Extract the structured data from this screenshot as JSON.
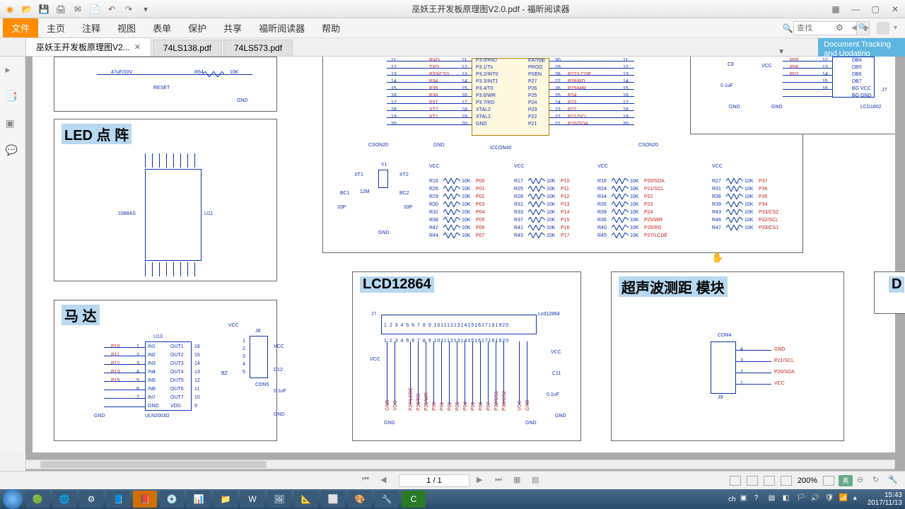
{
  "title": "巫妖王开发板原理图V2.0.pdf - 福昕阅读器",
  "menu": [
    "文件",
    "主页",
    "注释",
    "视图",
    "表单",
    "保护",
    "共享",
    "福昕阅读器",
    "帮助"
  ],
  "active_menu_index": 0,
  "search_placeholder": "查找",
  "tabs": [
    {
      "label": "巫妖王开发板原理图V2...",
      "active": true,
      "closeable": true
    },
    {
      "label": "74LS138.pdf",
      "active": false
    },
    {
      "label": "74LS573.pdf",
      "active": false
    }
  ],
  "tracking_banner_l1": "Document Tracking",
  "tracking_banner_l2": "and Updating",
  "page_indicator": "1 / 1",
  "zoom": "200%",
  "lang_toggle": "英",
  "clock_time": "15:43",
  "clock_date": "2017/11/13",
  "ime": "ch",
  "blocks": {
    "reset": {
      "cap": "47uF/10V",
      "res": "R64",
      "rval": "10K",
      "label": "RESET",
      "gnd": "GND"
    },
    "led": {
      "title": "LED 点    阵",
      "u": "U11",
      "ref": "1088AS"
    },
    "motor": {
      "title": "马 达",
      "u": "U13",
      "chip": "ULN2003D",
      "con": "CON5",
      "j": "J8",
      "vcc": "VCC",
      "gnd": "GND",
      "cap": "C12",
      "capv": "0.1uF",
      "bz": "BZ",
      "left_pins": [
        "P10",
        "P11",
        "P12",
        "P13",
        "P15"
      ],
      "left_nums": [
        "1",
        "2",
        "3",
        "4",
        "5",
        "6",
        "7"
      ],
      "in_labels": [
        "IN1",
        "IN2",
        "IN3",
        "IN4",
        "IN5",
        "IN6",
        "IN7",
        "GND"
      ],
      "out_labels": [
        "OUT1",
        "OUT2",
        "OUT3",
        "OUT4",
        "OUT5",
        "OUT6",
        "OUT7",
        "VDD"
      ],
      "right_nums": [
        "16",
        "15",
        "14",
        "13",
        "12",
        "11",
        "10",
        "9"
      ],
      "jnums": [
        "1",
        "2",
        "3",
        "4",
        "5"
      ]
    },
    "mcu": {
      "left_con": "CSON20",
      "ic": "ICCON40",
      "right_con": "CSON20",
      "gnd": "GND",
      "rows": [
        {
          "ln": "11",
          "lp": "RXD",
          "lm": "11",
          "sig": "P3.0/RxD",
          "rsig": "EA/Vpp",
          "rn": "30",
          "rp": "",
          "re": "11"
        },
        {
          "ln": "12",
          "lp": "TXD",
          "lm": "12",
          "sig": "P3.1/Tx",
          "rsig": "PROG",
          "rn": "29",
          "rp": "",
          "re": "12"
        },
        {
          "ln": "13",
          "lp": "P33/CS3",
          "lm": "13",
          "sig": "P3.2/INT0",
          "rsig": "PSEN",
          "rn": "28",
          "rp": "P27/LCDE",
          "re": "13"
        },
        {
          "ln": "14",
          "lp": "P34",
          "lm": "14",
          "sig": "P3.3/INT1",
          "rsig": "P27",
          "rn": "27",
          "rp": "P26/RD",
          "re": "14"
        },
        {
          "ln": "15",
          "lp": "P35",
          "lm": "15",
          "sig": "P3.4/T0",
          "rsig": "P26",
          "rn": "26",
          "rp": "P25/WR",
          "re": "15"
        },
        {
          "ln": "16",
          "lp": "P36",
          "lm": "16",
          "sig": "P3.6/WR",
          "rsig": "P25",
          "rn": "25",
          "rp": "P24",
          "re": "16"
        },
        {
          "ln": "17",
          "lp": "P37",
          "lm": "17",
          "sig": "P3.7/RD",
          "rsig": "P24",
          "rn": "24",
          "rp": "P23",
          "re": "17"
        },
        {
          "ln": "18",
          "lp": "XT2",
          "lm": "18",
          "sig": "XTAL2",
          "rsig": "P23",
          "rn": "23",
          "rp": "P22",
          "re": "18"
        },
        {
          "ln": "19",
          "lp": "XT1",
          "lm": "19",
          "sig": "XTAL1",
          "rsig": "P22",
          "rn": "22",
          "rp": "P21/SCL",
          "re": "19"
        },
        {
          "ln": "20",
          "lp": "",
          "lm": "20",
          "sig": "GND",
          "rsig": "P21",
          "rn": "21",
          "rp": "P20/SDA",
          "re": "20"
        }
      ],
      "xtal": {
        "y": "Y1",
        "val": "12M",
        "xt1": "XT1",
        "xt2": "XT2",
        "bc1": "BC1",
        "bc2": "BC2",
        "bcv": "33P",
        "gnd": "GND"
      },
      "rbank_headers": [
        "VCC",
        "VCC",
        "VCC",
        "VCC"
      ],
      "rbanks": [
        [
          {
            "r": "R16",
            "v": "10K",
            "n": "P00"
          },
          {
            "r": "R26",
            "v": "10K",
            "n": "P01"
          },
          {
            "r": "R29",
            "v": "10K",
            "n": "P02"
          },
          {
            "r": "R30",
            "v": "10K",
            "n": "P03"
          },
          {
            "r": "R32",
            "v": "10K",
            "n": "P04"
          },
          {
            "r": "R38",
            "v": "10K",
            "n": "P05"
          },
          {
            "r": "R42",
            "v": "10K",
            "n": "P06"
          },
          {
            "r": "R44",
            "v": "10K",
            "n": "P07"
          }
        ],
        [
          {
            "r": "R17",
            "v": "10K",
            "n": "P10"
          },
          {
            "r": "R25",
            "v": "10K",
            "n": "P11"
          },
          {
            "r": "R28",
            "v": "10K",
            "n": "P12"
          },
          {
            "r": "R31",
            "v": "10K",
            "n": "P13"
          },
          {
            "r": "R33",
            "v": "10K",
            "n": "P14"
          },
          {
            "r": "R37",
            "v": "10K",
            "n": "P15"
          },
          {
            "r": "R41",
            "v": "10K",
            "n": "P16"
          },
          {
            "r": "R43",
            "v": "10K",
            "n": "P17"
          }
        ],
        [
          {
            "r": "R18",
            "v": "10K",
            "n": "P20/SDA"
          },
          {
            "r": "R24",
            "v": "10K",
            "n": "P21/SCL"
          },
          {
            "r": "R34",
            "v": "10K",
            "n": "P22"
          },
          {
            "r": "R35",
            "v": "10K",
            "n": "P23"
          },
          {
            "r": "R39",
            "v": "10K",
            "n": "P24"
          },
          {
            "r": "R36",
            "v": "10K",
            "n": "P25/WR"
          },
          {
            "r": "R40",
            "v": "10K",
            "n": "P26/RD"
          },
          {
            "r": "R45",
            "v": "10K",
            "n": "P27/LCDE"
          }
        ],
        [
          {
            "r": "R27",
            "v": "10K",
            "n": "P37"
          },
          {
            "r": "R31",
            "v": "10K",
            "n": "P36"
          },
          {
            "r": "R36",
            "v": "10K",
            "n": "P35"
          },
          {
            "r": "R39",
            "v": "10K",
            "n": "P34"
          },
          {
            "r": "R43",
            "v": "10K",
            "n": "P33/CS2"
          },
          {
            "r": "R46",
            "v": "10K",
            "n": "P32/SCL"
          },
          {
            "r": "R47",
            "v": "10K",
            "n": "P33/CS1"
          }
        ]
      ]
    },
    "lcd1602": {
      "c": "C8",
      "vcc": "VCC",
      "gnd": "GND",
      "ref": "LCD1602",
      "j": "J7",
      "cap": "0.1uF",
      "rows": [
        {
          "p": "P05",
          "n": "12",
          "d": "DB4"
        },
        {
          "p": "P06",
          "n": "13",
          "d": "DB5"
        },
        {
          "p": "P07",
          "n": "14",
          "d": "DB6"
        },
        {
          "p": "",
          "n": "15",
          "d": "DB7"
        },
        {
          "p": "",
          "n": "16",
          "d": "BG VCC"
        },
        {
          "p": "",
          "n": "",
          "d": "BG GND"
        }
      ]
    },
    "lcd12864": {
      "title": "LCD12864",
      "j": "J7",
      "ref": "Lcd12864",
      "vcc": "VCC",
      "gnd": "GND",
      "cap": "C11",
      "capv": "0.1uF",
      "nums": "1 2 3 4 5 6 7 8 9 1011121314151617181920",
      "nets": [
        "GND",
        "VCC",
        "",
        "P27/LCDE",
        "P26/RD",
        "P25/WR",
        "P00",
        "P01",
        "P02",
        "P03",
        "P04",
        "P05",
        "P06",
        "P07",
        "P32/CS1",
        "P33/CS2",
        "",
        "VCC",
        "GND",
        ""
      ]
    },
    "ultra": {
      "title": "超声波测距  模块",
      "con": "CON4",
      "j": "J9",
      "pins": [
        {
          "n": "4",
          "net": "GND"
        },
        {
          "n": "3",
          "net": "P21/SCL"
        },
        {
          "n": "2",
          "net": "P20/SDA"
        },
        {
          "n": "1",
          "net": "VCC"
        }
      ]
    },
    "partial": {
      "title": "D"
    }
  }
}
